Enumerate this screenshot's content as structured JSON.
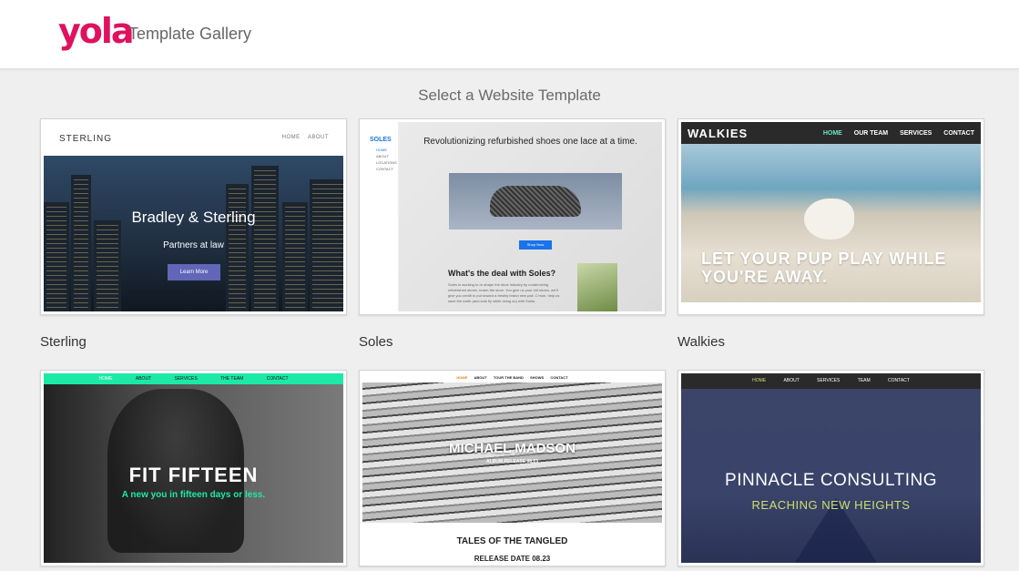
{
  "header": {
    "logo_text": "yola",
    "title": "Template Gallery"
  },
  "page": {
    "subtitle": "Select a Website Template"
  },
  "templates": {
    "sterling": {
      "label": "Sterling",
      "brand": "STERLING",
      "nav": [
        "HOME",
        "ABOUT"
      ],
      "hero_title": "Bradley & Sterling",
      "hero_sub": "Partners at law",
      "button": "Learn More"
    },
    "soles": {
      "label": "Soles",
      "brand": "SOLES",
      "nav": [
        "HOME",
        "ABOUT",
        "LOCATIONS",
        "CONTACT"
      ],
      "headline": "Revolutionizing refurbished shoes one lace at a time.",
      "button": "Shop Now",
      "section_title": "What's the deal with Soles?",
      "section_text": "Soles is working to re-shape the shoe industry by modernizing refurbished shoes, rearm the shoe. You give us your old shoes, we'll give you credit to put toward a freshly brand new pair. C'mon, help us save the earth (and look fly while doing so) with Soles."
    },
    "walkies": {
      "label": "Walkies",
      "brand": "WALKIES",
      "nav": [
        "HOME",
        "OUR TEAM",
        "SERVICES",
        "CONTACT"
      ],
      "tagline": "LET YOUR PUP PLAY WHILE YOU'RE AWAY."
    },
    "fit_fifteen": {
      "nav": [
        "HOME",
        "ABOUT",
        "SERVICES",
        "THE TEAM",
        "CONTACT"
      ],
      "title": "FIT FIFTEEN",
      "sub": "A new you in fifteen days or less."
    },
    "michael_madson": {
      "nav": [
        "HOME",
        "ABOUT",
        "TOUR THE BAND",
        "SHOWS",
        "CONTACT"
      ],
      "title": "MICHAEL MADSON",
      "sub": "ALBUM RELEASE 08.23",
      "footer_title": "TALES OF THE TANGLED",
      "footer_sub": "RELEASE DATE 08.23"
    },
    "pinnacle": {
      "nav": [
        "HOME",
        "ABOUT",
        "SERVICES",
        "TEAM",
        "CONTACT"
      ],
      "title": "PINNACLE CONSULTING",
      "sub": "REACHING NEW HEIGHTS"
    }
  },
  "colors": {
    "logo": "#e0115f",
    "background": "#efefef",
    "fit_fifteen_accent": "#1de9a6",
    "pinnacle_accent": "#c9e06b",
    "soles_accent": "#1a73e8",
    "sterling_button": "#6166b8"
  }
}
